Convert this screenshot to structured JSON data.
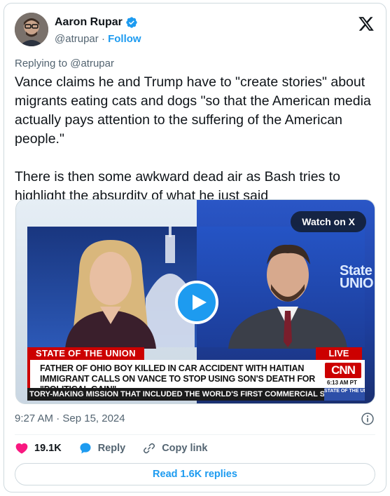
{
  "author": {
    "display_name": "Aaron Rupar",
    "handle": "@atrupar",
    "separator": "·",
    "follow_label": "Follow",
    "verified": true
  },
  "reply_to": "Replying to @atrupar",
  "tweet": {
    "paragraphs": [
      "Vance claims he and Trump have to \"create stories\" about migrants eating cats and dogs \"so that the American media actually pays attention to the suffering of the American people.\"",
      "There is then some awkward dead air as Bash tries to highlight the absurdity of what he just said"
    ]
  },
  "media": {
    "watch_label": "Watch on X",
    "chyron_label": "STATE OF THE UNION",
    "live_label": "LIVE",
    "headline": "FATHER OF OHIO BOY KILLED IN CAR ACCIDENT WITH HAITIAN IMMIGRANT CALLS ON VANCE TO STOP USING SON'S DEATH FOR \"POLITICAL GAIN\"",
    "network": "CNN",
    "time": "6:13 AM PT",
    "ticker": "TORY-MAKING MISSION THAT INCLUDED THE WORLD'S FIRST COMMERCIAL SPACEWA",
    "ticker_tag": "STATE OF THE UNION",
    "background_logo": "State UNIO"
  },
  "timestamp": "9:27 AM · Sep 15, 2024",
  "actions": {
    "likes": "19.1K",
    "reply_label": "Reply",
    "copy_link_label": "Copy link"
  },
  "read_replies_label": "Read 1.6K replies",
  "colors": {
    "accent": "#1d9bf0",
    "like": "#f91880",
    "cnn_red": "#cc0000",
    "text": "#0f1419",
    "muted": "#536471"
  }
}
